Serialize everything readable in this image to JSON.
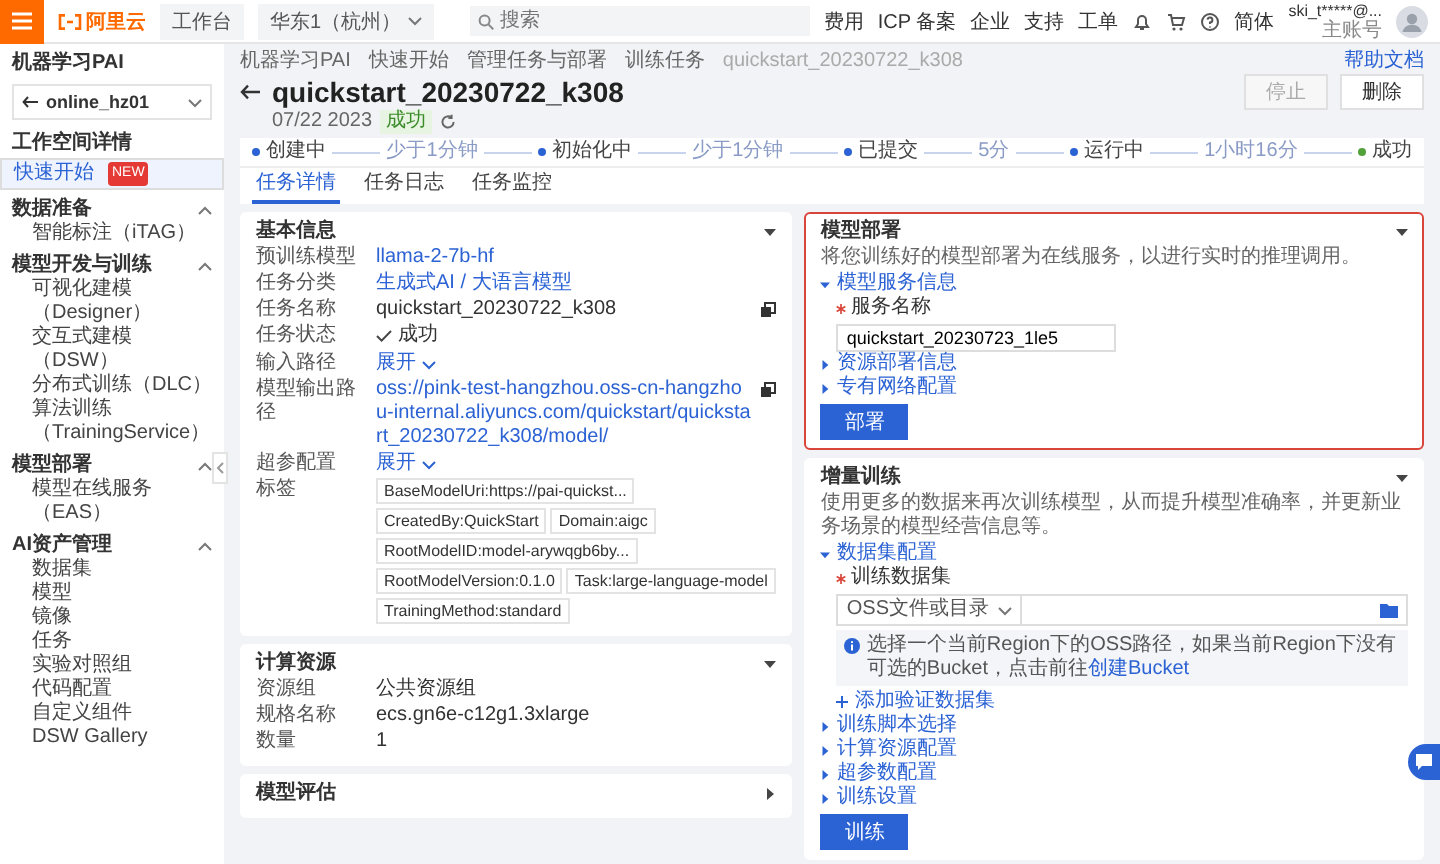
{
  "topbar": {
    "logo": "阿里云",
    "workbench": "工作台",
    "region": "华东1（杭州）",
    "search": {
      "placeholder": "搜索"
    },
    "links": [
      "费用",
      "ICP 备案",
      "企业",
      "支持",
      "工单"
    ],
    "language": "简体",
    "user": {
      "name": "ski_t*****@...",
      "role": "主账号"
    }
  },
  "sidebar": {
    "title": "机器学习PAI",
    "workspace": "online_hz01",
    "links": [
      {
        "label": "工作空间详情",
        "selected": false
      },
      {
        "label": "快速开始",
        "badge": "NEW",
        "selected": true
      }
    ],
    "groups": [
      {
        "label": "数据准备",
        "expanded": true,
        "items": [
          "智能标注（iTAG）"
        ]
      },
      {
        "label": "模型开发与训练",
        "expanded": true,
        "items": [
          "可视化建模（Designer）",
          "交互式建模（DSW）",
          "分布式训练（DLC）",
          "算法训练（TrainingService）"
        ]
      },
      {
        "label": "模型部署",
        "expanded": true,
        "items": [
          "模型在线服务（EAS）"
        ]
      },
      {
        "label": "AI资产管理",
        "expanded": true,
        "items": [
          "数据集",
          "模型",
          "镜像",
          "任务",
          "实验对照组",
          "代码配置",
          "自定义组件",
          "DSW Gallery"
        ]
      }
    ]
  },
  "breadcrumb": [
    "机器学习PAI",
    "快速开始",
    "管理任务与部署",
    "训练任务",
    "quickstart_20230722_k308"
  ],
  "help_link": "帮助文档",
  "header": {
    "title": "quickstart_20230722_k308",
    "date": "07/22 2023",
    "status": "成功",
    "buttons": [
      {
        "label": "停止",
        "disabled": true
      },
      {
        "label": "删除",
        "disabled": false
      }
    ]
  },
  "steps": [
    {
      "label": "创建中",
      "duration": "少于1分钟",
      "color": "#2b62d4"
    },
    {
      "label": "初始化中",
      "duration": "少于1分钟",
      "color": "#2b62d4"
    },
    {
      "label": "已提交",
      "duration": "5分",
      "color": "#2b62d4"
    },
    {
      "label": "运行中",
      "duration": "1小时16分",
      "color": "#2b62d4"
    },
    {
      "label": "成功",
      "color": "#52a13a"
    }
  ],
  "tabs": [
    {
      "label": "任务详情",
      "selected": true
    },
    {
      "label": "任务日志",
      "selected": false
    },
    {
      "label": "任务监控",
      "selected": false
    }
  ],
  "basic_info": {
    "title": "基本信息",
    "expanded": true,
    "fields": [
      {
        "label": "预训练模型",
        "kind": "link",
        "value": "llama-2-7b-hf"
      },
      {
        "label": "任务分类",
        "kind": "link",
        "value": "生成式AI / 大语言模型"
      },
      {
        "label": "任务名称",
        "kind": "text",
        "value": "quickstart_20230722_k308",
        "copyable": true
      },
      {
        "label": "任务状态",
        "kind": "status",
        "value": "成功"
      },
      {
        "label": "输入路径",
        "kind": "toggle",
        "value": "展开"
      },
      {
        "label": "模型输出路径",
        "kind": "link",
        "value": "oss://pink-test-hangzhou.oss-cn-hangzhou-internal.aliyuncs.com/quickstart/quickstart_20230722_k308/model/",
        "copyable": true
      },
      {
        "label": "超参配置",
        "kind": "toggle",
        "value": "展开"
      },
      {
        "label": "标签",
        "kind": "tags",
        "tags": [
          "BaseModelUri:https://pai-quickst...",
          "CreatedBy:QuickStart",
          "Domain:aigc",
          "RootModelID:model-arywqgb6by...",
          "RootModelVersion:0.1.0",
          "Task:large-language-model",
          "TrainingMethod:standard"
        ]
      }
    ]
  },
  "compute": {
    "title": "计算资源",
    "expanded": true,
    "fields": [
      {
        "label": "资源组",
        "value": "公共资源组"
      },
      {
        "label": "规格名称",
        "value": "ecs.gn6e-c12g1.3xlarge"
      },
      {
        "label": "数量",
        "value": "1"
      }
    ]
  },
  "evaluation": {
    "title": "模型评估",
    "expanded": false
  },
  "deploy": {
    "title": "模型部署",
    "expanded": true,
    "highlighted": true,
    "description": "将您训练好的模型部署为在线服务，以进行实时的推理调用。",
    "sections": [
      {
        "label": "模型服务信息",
        "expanded": true,
        "field": {
          "label": "服务名称",
          "required": true,
          "value": "quickstart_20230723_1le5"
        }
      },
      {
        "label": "资源部署信息",
        "expanded": false
      },
      {
        "label": "专有网络配置",
        "expanded": false
      }
    ],
    "button": "部署"
  },
  "training": {
    "title": "增量训练",
    "expanded": true,
    "highlighted": false,
    "description": "使用更多的数据来再次训练模型，从而提升模型准确率，并更新业务场景的模型经营信息等。",
    "sections": [
      {
        "label": "数据集配置",
        "expanded": true,
        "dataset": {
          "label": "训练数据集",
          "required": true,
          "source": "OSS文件或目录",
          "info": "选择一个当前Region下的OSS路径，如果当前Region下没有可选的Bucket，点击前往",
          "info_link": "创建Bucket",
          "add_link": "添加验证数据集"
        }
      },
      {
        "label": "训练脚本选择",
        "expanded": false
      },
      {
        "label": "计算资源配置",
        "expanded": false
      },
      {
        "label": "超参数配置",
        "expanded": false
      },
      {
        "label": "训练设置",
        "expanded": false
      }
    ],
    "button": "训练"
  }
}
